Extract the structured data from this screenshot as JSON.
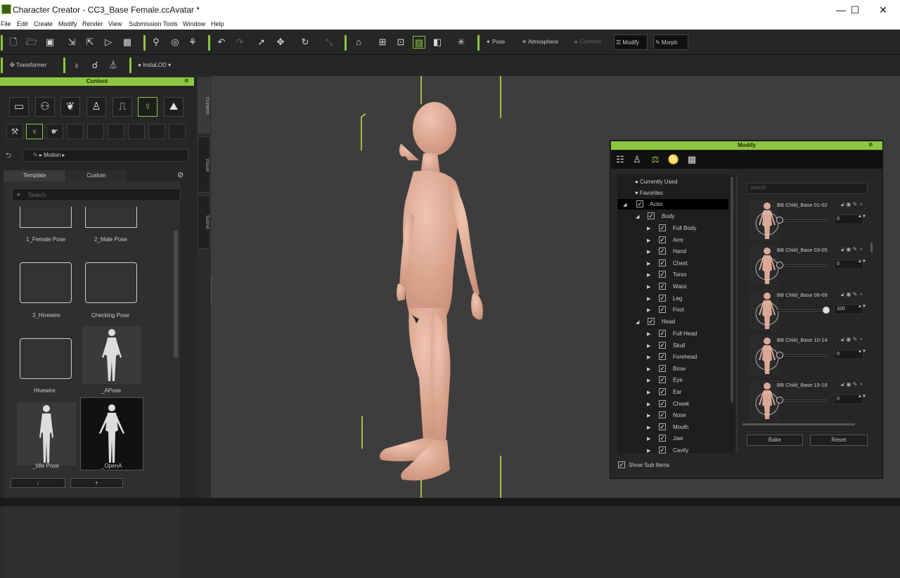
{
  "window": {
    "title": "Character Creator - CC3_Base Female.ccAvatar *",
    "min": "—",
    "max": "☐",
    "close": "✕"
  },
  "menu": [
    "File",
    "Edit",
    "Create",
    "Modify",
    "Render",
    "View",
    "Submission Tools",
    "Window",
    "Help"
  ],
  "toolbar": {
    "pose": "Pose",
    "atmosphere": "Atmosphere",
    "conform": "Conform",
    "modify": "Modify",
    "morph": "Morph",
    "transformer": "Transformer",
    "instalod": "InstaLOD"
  },
  "content": {
    "header": "Content",
    "path": "Motion",
    "tabs": {
      "template": "Template",
      "custom": "Custom"
    },
    "search_placeholder": "Search",
    "items": [
      {
        "label": "1_Female Pose",
        "kind": "folder"
      },
      {
        "label": "2_Male Pose",
        "kind": "folder"
      },
      {
        "label": "3_Hivewire",
        "kind": "folder"
      },
      {
        "label": "Checking Pose",
        "kind": "folder"
      },
      {
        "label": "Hivewire",
        "kind": "folder"
      },
      {
        "label": "_APose",
        "kind": "figure"
      },
      {
        "label": "_Idle Pose",
        "kind": "figure"
      },
      {
        "label": "_OpenA",
        "kind": "figure"
      }
    ],
    "bottom_buttons": [
      "↓",
      "+"
    ]
  },
  "vtabs": [
    "Content",
    "Visual",
    "Scene"
  ],
  "modify": {
    "header": "Modify",
    "tree": {
      "currently_used": "Currently Used",
      "favorites": "Favorites",
      "actor": "Actor",
      "body": "Body",
      "body_items": [
        "Full Body",
        "Arm",
        "Hand",
        "Chest",
        "Torso",
        "Waist",
        "Leg",
        "Foot"
      ],
      "head": "Head",
      "head_items": [
        "Full Head",
        "Skull",
        "Forehead",
        "Brow",
        "Eye",
        "Ear",
        "Cheek",
        "Nose",
        "Mouth",
        "Jaw",
        "Cavity"
      ]
    },
    "show_sub_items": "Show Sub Items",
    "search_placeholder": "Search",
    "morphs": [
      {
        "name": "BB Child_Base 01-02",
        "value": "0",
        "level": 0
      },
      {
        "name": "BB Child_Base 03-05",
        "value": "0",
        "level": 0
      },
      {
        "name": "BB Child_Base 06-09",
        "value": "100",
        "level": 1
      },
      {
        "name": "BB Child_Base 10-14",
        "value": "0",
        "level": 0
      },
      {
        "name": "BB Child_Base 15-18",
        "value": "0",
        "level": 0
      }
    ],
    "bake": "Bake",
    "reset": "Reset"
  },
  "colors": {
    "accent": "#8dc63f",
    "skin": "#e5b49e"
  }
}
